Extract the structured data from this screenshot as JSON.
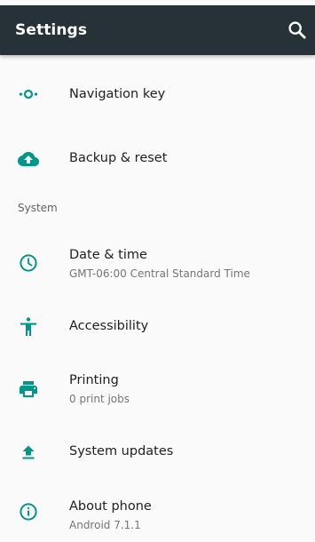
{
  "appbar": {
    "title": "Settings",
    "search_icon": "search-icon"
  },
  "items_top": [
    {
      "label": "Navigation key",
      "icon": "navigation-key-icon"
    },
    {
      "label": "Backup & reset",
      "icon": "cloud-upload-icon"
    }
  ],
  "section": {
    "title": "System"
  },
  "items_system": [
    {
      "label": "Date & time",
      "subtitle": "GMT-06:00 Central Standard Time",
      "icon": "clock-icon"
    },
    {
      "label": "Accessibility",
      "icon": "accessibility-icon"
    },
    {
      "label": "Printing",
      "subtitle": "0 print jobs",
      "icon": "printer-icon"
    },
    {
      "label": "System updates",
      "icon": "upload-icon"
    },
    {
      "label": "About phone",
      "subtitle": "Android 7.1.1",
      "icon": "info-icon"
    }
  ],
  "colors": {
    "appbar": "#263238",
    "accent": "#009688",
    "background": "#fafafa"
  }
}
